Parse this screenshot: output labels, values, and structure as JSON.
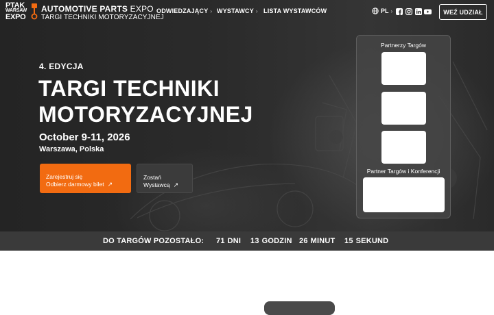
{
  "logo": {
    "ptak_line1": "PTAK",
    "ptak_line2": "WARSAW",
    "ptak_line3": "EXPO",
    "expo_bold": "AUTOMOTIVE PARTS",
    "expo_thin": "EXPO",
    "expo_sub": "TARGI TECHNIKI MOTORYZACYJNEJ",
    "accent": "#f26b11"
  },
  "nav": {
    "items": [
      {
        "label": "ODWIEDZAJĄCY",
        "chevron": "›"
      },
      {
        "label": "WYSTAWCY",
        "chevron": "›"
      },
      {
        "label": "LISTA WYSTAWCÓW"
      }
    ],
    "lang": "PL",
    "lang_chevron": "›",
    "social_icons": [
      "facebook-icon",
      "instagram-icon",
      "linkedin-icon",
      "youtube-icon"
    ],
    "cta": "WEŹ UDZIAŁ"
  },
  "hero": {
    "edition": "4. EDYCJA",
    "title": "TARGI TECHNIKI MOTORYZACYJNEJ",
    "dates": "October 9-11, 2026",
    "place": "Warszawa, Polska",
    "register_line1": "Zarejestruj się",
    "register_line2": "Odbierz darmowy bilet",
    "exhibitor_line1": "Zostań",
    "exhibitor_line2": "Wystawcą",
    "arrow": "↗",
    "register_color": "#f26b11"
  },
  "partners": {
    "title": "Partnerzy Targów",
    "conference_title": "Partner Targów i Konferencji"
  },
  "countdown": {
    "label": "DO TARGÓW POZOSTAŁO:",
    "days_value": "71",
    "days_unit": "DNI",
    "hours_value": "13",
    "hours_unit": "GODZIN",
    "minutes_value": "26",
    "minutes_unit": "MINUT",
    "seconds_value": "15",
    "seconds_unit": "SEKUND"
  }
}
